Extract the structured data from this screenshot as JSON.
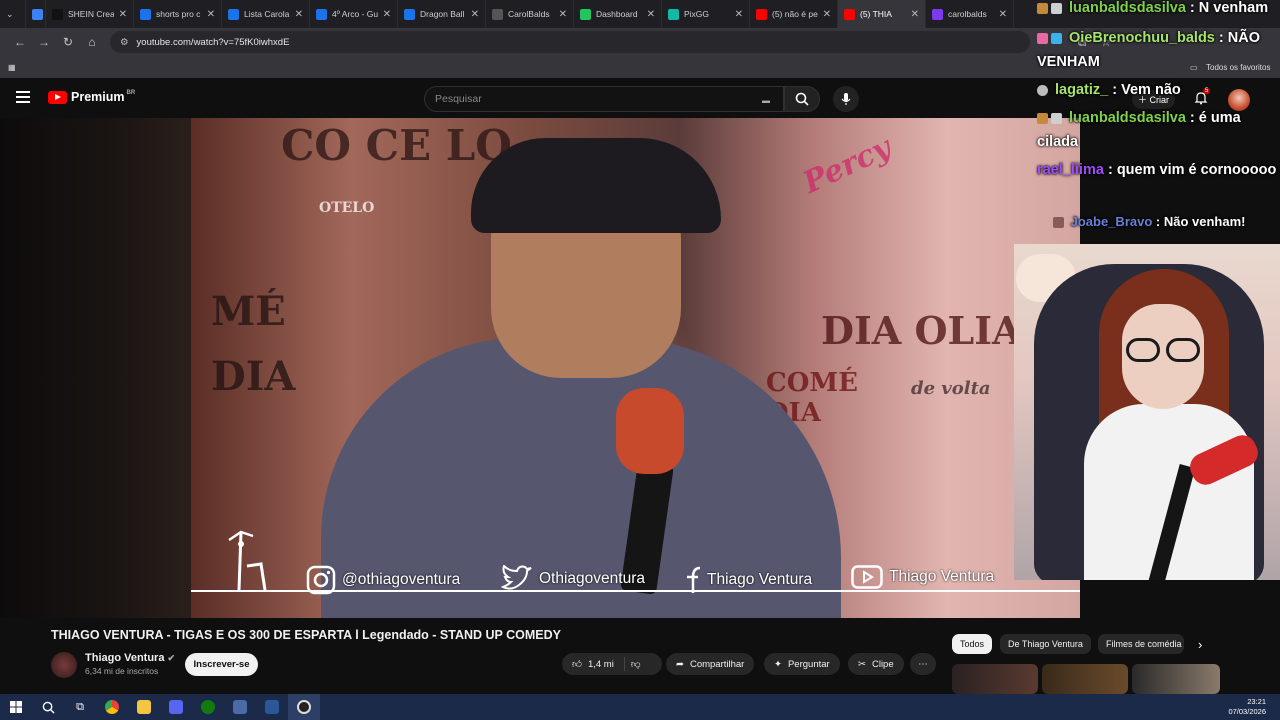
{
  "browser": {
    "tabs": [
      {
        "label": "",
        "color": "#3b82f6"
      },
      {
        "label": "SHEIN Crea",
        "color": "#111111"
      },
      {
        "label": "shorts pro c",
        "color": "#1a73e8"
      },
      {
        "label": "Lista Carola",
        "color": "#1a73e8"
      },
      {
        "label": "4º Arco - Gu",
        "color": "#1a73e8"
      },
      {
        "label": "Dragon Ball",
        "color": "#1a73e8"
      },
      {
        "label": "CarolBalds",
        "color": "#555555"
      },
      {
        "label": "Dashboard",
        "color": "#22c55e"
      },
      {
        "label": "PixGG",
        "color": "#14b8a6"
      },
      {
        "label": "(5) não é pe",
        "color": "#ff0000"
      },
      {
        "label": "(5) THIA",
        "color": "#ff0000"
      },
      {
        "label": "carolbalds",
        "color": "#7c3aed"
      }
    ],
    "url": "youtube.com/watch?v=75fK0iwhxdE",
    "bookmarks_label": "Todos os favoritos"
  },
  "youtube": {
    "logo_text": "Premium",
    "logo_region": "BR",
    "search_placeholder": "Pesquisar",
    "create_label": "Criar",
    "notification_count": "5"
  },
  "video": {
    "social": [
      {
        "icon": "instagram-icon",
        "text": "@othiagoventura"
      },
      {
        "icon": "twitter-icon",
        "text": "Othiagoventura"
      },
      {
        "icon": "facebook-icon",
        "text": "Thiago Ventura"
      },
      {
        "icon": "youtube-icon",
        "text": "Thiago Ventura"
      }
    ],
    "posters": [
      "CO CE LO",
      "OTELO",
      "MÉ",
      "DIA",
      "DIA OLIAS",
      "COMÉ DIA",
      "de volta",
      "Percy"
    ],
    "title": "THIAGO VENTURA - TIGAS E OS 300 DE ESPARTA l Legendado - STAND UP COMEDY",
    "channel": "Thiago Ventura",
    "subscribers": "6,34 mi de inscritos",
    "subscribe_label": "Inscrever-se",
    "likes": "1,4 mi",
    "share_label": "Compartilhar",
    "ask_label": "Perguntar",
    "clip_label": "Clipe"
  },
  "recommend_chips": [
    "Todos",
    "De Thiago Ventura",
    "Filmes de comédia"
  ],
  "chat": [
    {
      "user": "luanbaldsdasilva",
      "text": "N venham",
      "color": "#7fd14a"
    },
    {
      "user": "OieBrenochuu_balds",
      "text": "NÃO VENHAM",
      "color": "#a6e36a"
    },
    {
      "user": "lagatiz_",
      "text": "Vem não",
      "color": "#a6e36a"
    },
    {
      "user": "luanbaldsdasilva",
      "text": "é uma cilada",
      "color": "#7fd14a"
    },
    {
      "user": "rael_liima",
      "text": "quem vim é cornooooo",
      "color": "#9d4dff"
    },
    {
      "user": "Joabe_Bravo",
      "text": "Não venham!",
      "color": "#6a7fd8"
    }
  ],
  "clock": {
    "time": "23:21",
    "date": "07/03/2026"
  }
}
